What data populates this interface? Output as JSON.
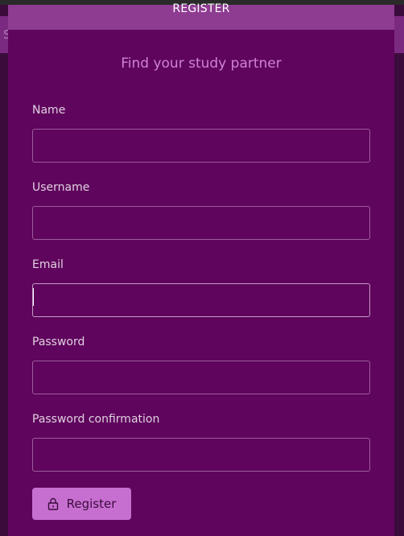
{
  "background": {
    "banner_partial_text": "S"
  },
  "modal": {
    "header_title": "REGISTER",
    "subtitle": "Find your study partner"
  },
  "form": {
    "fields": [
      {
        "label": "Name",
        "value": "",
        "placeholder": ""
      },
      {
        "label": "Username",
        "value": "",
        "placeholder": ""
      },
      {
        "label": "Email",
        "value": "",
        "placeholder": ""
      },
      {
        "label": "Password",
        "value": "",
        "placeholder": ""
      },
      {
        "label": "Password confirmation",
        "value": "",
        "placeholder": ""
      }
    ],
    "focused_field": "Email",
    "submit_label": "Register",
    "submit_icon": "lock-icon"
  },
  "colors": {
    "modal_bg": "#5f055d",
    "header_bg": "#8e3c92",
    "accent": "#cf83d6",
    "button_bg": "#c76fd0"
  }
}
